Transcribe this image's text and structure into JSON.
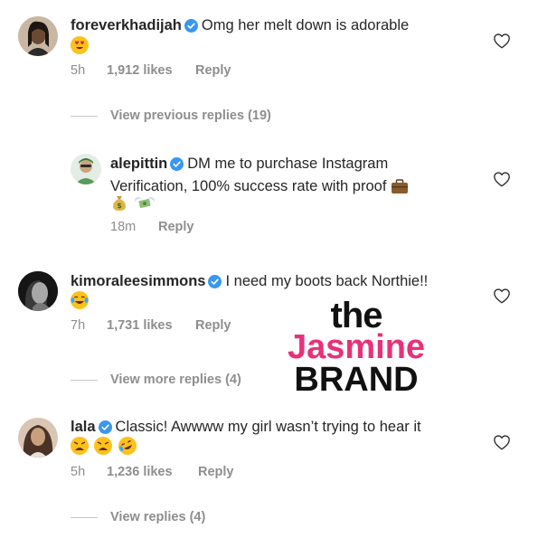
{
  "comments": [
    {
      "username": "foreverkhadijah",
      "text": "Omg her melt down is adorable",
      "emojis": [
        "heart-eyes"
      ],
      "time": "5h",
      "likes": "1,912 likes",
      "reply": "Reply"
    },
    {
      "username": "alepittin",
      "text_line1": "DM me to purchase Instagram",
      "text_line2": "Verification, 100% success rate with proof",
      "emojis": [
        "briefcase",
        "money-bag",
        "money-with-wings"
      ],
      "time": "18m",
      "reply": "Reply"
    },
    {
      "username": "kimoraleesimmons",
      "text": "I need my boots back Northie!!",
      "emojis": [
        "tears-of-joy"
      ],
      "time": "7h",
      "likes": "1,731 likes",
      "reply": "Reply"
    },
    {
      "username": "lala",
      "text": "Classic! Awwww my girl wasn’t trying to hear it",
      "emojis": [
        "weary",
        "weary",
        "rolling-laughing"
      ],
      "time": "5h",
      "likes": "1,236 likes",
      "reply": "Reply"
    }
  ],
  "view_previous_replies": "View previous replies (19)",
  "view_more_replies": "View more replies (4)",
  "view_replies": "View replies (4)",
  "watermark": {
    "line1": "the",
    "line2": "Jasmine",
    "line3": "BRAND"
  },
  "colors": {
    "verified_blue": "#3897f0",
    "meta_gray": "#8e8e8e",
    "watermark_pink": "#e8317a"
  }
}
